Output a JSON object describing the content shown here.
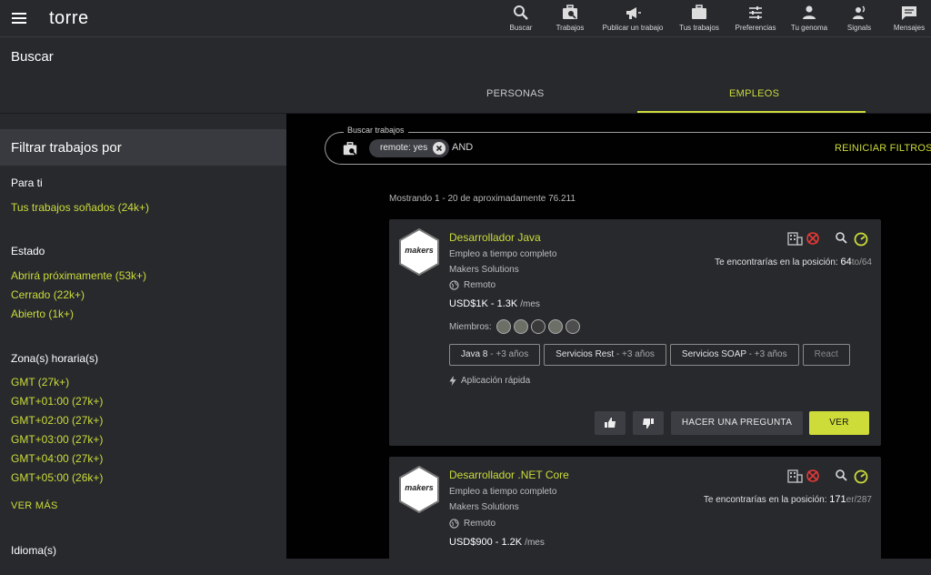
{
  "app": {
    "logo": "torre"
  },
  "nav": [
    {
      "label": "Buscar",
      "icon": "search-icon"
    },
    {
      "label": "Trabajos",
      "icon": "briefcase-search-icon"
    },
    {
      "label": "Publicar un trabajo",
      "icon": "megaphone-icon"
    },
    {
      "label": "Tus trabajos",
      "icon": "briefcase-icon"
    },
    {
      "label": "Preferencias",
      "icon": "sliders-icon"
    },
    {
      "label": "Tu genoma",
      "icon": "person-icon"
    },
    {
      "label": "Signals",
      "icon": "signal-person-icon"
    },
    {
      "label": "Mensajes",
      "icon": "chat-icon"
    }
  ],
  "page": {
    "title": "Buscar"
  },
  "tabs": [
    {
      "label": "PERSONAS"
    },
    {
      "label": "EMPLEOS"
    }
  ],
  "sidebar": {
    "header": "Filtrar trabajos por",
    "para_ti": {
      "title": "Para ti",
      "items": [
        "Tus trabajos soñados (24k+)"
      ]
    },
    "estado": {
      "title": "Estado",
      "items": [
        "Abrirá próximamente (53k+)",
        "Cerrado (22k+)",
        "Abierto (1k+)"
      ]
    },
    "zona": {
      "title": "Zona(s) horaria(s)",
      "items": [
        "GMT (27k+)",
        "GMT+01:00 (27k+)",
        "GMT+02:00 (27k+)",
        "GMT+03:00 (27k+)",
        "GMT+04:00 (27k+)",
        "GMT+05:00 (26k+)"
      ]
    },
    "ver_mas": "VER MÁS",
    "idioma": {
      "title": "Idioma(s)"
    }
  },
  "search": {
    "label": "Buscar trabajos",
    "chip": "remote: yes",
    "operator": "AND",
    "reset": "REINICIAR FILTROS"
  },
  "results": {
    "count_text": "Mostrando 1 - 20 de aproximadamente 76.211"
  },
  "cards": [
    {
      "logo_text": "makers",
      "title": "Desarrollador Java",
      "type": "Empleo a tiempo completo",
      "company": "Makers Solutions",
      "location": "Remoto",
      "salary": "USD$1K - 1.3K",
      "salary_unit": "/mes",
      "position_label": "Te encontrarías en la posición:",
      "position_rank": "64",
      "position_total": "to/64",
      "members_label": "Miembros:",
      "skills": [
        {
          "name": "Java 8",
          "exp": " - +3 años"
        },
        {
          "name": "Servicios Rest",
          "exp": " - +3 años"
        },
        {
          "name": "Servicios SOAP",
          "exp": " - +3 años"
        },
        {
          "name": "React",
          "exp": ""
        }
      ],
      "quick": "Aplicación rápida",
      "ask": "HACER UNA PREGUNTA",
      "view": "VER"
    },
    {
      "logo_text": "makers",
      "title": "Desarrollador .NET Core",
      "type": "Empleo a tiempo completo",
      "company": "Makers Solutions",
      "location": "Remoto",
      "salary": "USD$900 - 1.2K",
      "salary_unit": "/mes",
      "position_label": "Te encontrarías en la posición:",
      "position_rank": "171",
      "position_total": "er/287"
    }
  ],
  "colors": {
    "accent": "#cddc39",
    "bg": "#27292d",
    "main_bg": "#010101",
    "card": "#27292d"
  }
}
